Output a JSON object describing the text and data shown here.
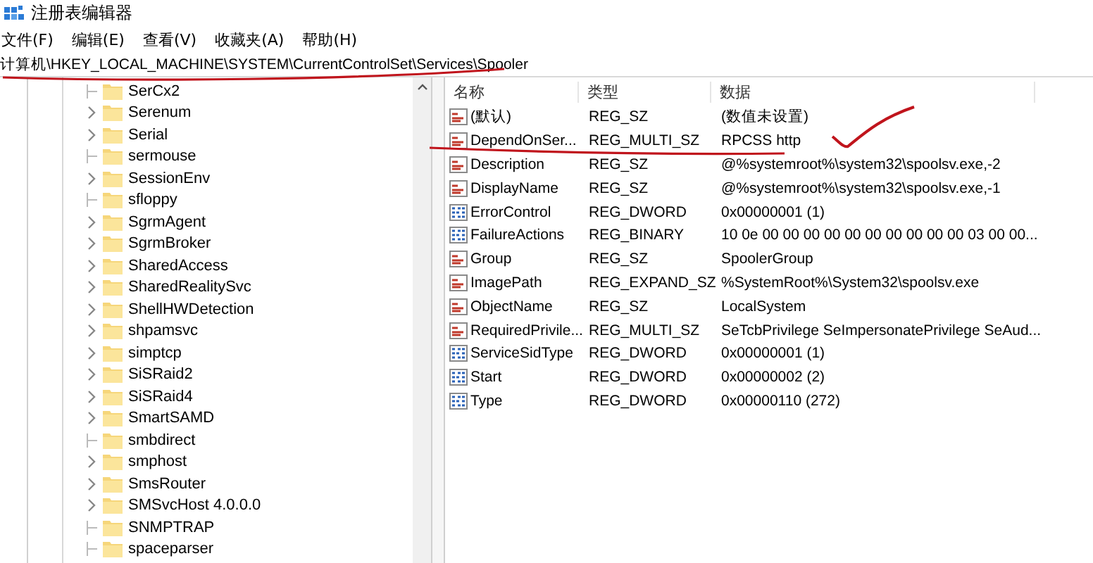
{
  "window": {
    "title": "注册表编辑器"
  },
  "menu": [
    "文件(F)",
    "编辑(E)",
    "查看(V)",
    "收藏夹(A)",
    "帮助(H)"
  ],
  "address": "计算机\\HKEY_LOCAL_MACHINE\\SYSTEM\\CurrentControlSet\\Services\\Spooler",
  "tree": [
    {
      "label": "SerCx2",
      "expandable": false
    },
    {
      "label": "Serenum",
      "expandable": true
    },
    {
      "label": "Serial",
      "expandable": true
    },
    {
      "label": "sermouse",
      "expandable": false
    },
    {
      "label": "SessionEnv",
      "expandable": true
    },
    {
      "label": "sfloppy",
      "expandable": false
    },
    {
      "label": "SgrmAgent",
      "expandable": true
    },
    {
      "label": "SgrmBroker",
      "expandable": true
    },
    {
      "label": "SharedAccess",
      "expandable": true
    },
    {
      "label": "SharedRealitySvc",
      "expandable": true
    },
    {
      "label": "ShellHWDetection",
      "expandable": true
    },
    {
      "label": "shpamsvc",
      "expandable": true
    },
    {
      "label": "simptcp",
      "expandable": true
    },
    {
      "label": "SiSRaid2",
      "expandable": true
    },
    {
      "label": "SiSRaid4",
      "expandable": true
    },
    {
      "label": "SmartSAMD",
      "expandable": true
    },
    {
      "label": "smbdirect",
      "expandable": false
    },
    {
      "label": "smphost",
      "expandable": true
    },
    {
      "label": "SmsRouter",
      "expandable": true
    },
    {
      "label": "SMSvcHost 4.0.0.0",
      "expandable": true
    },
    {
      "label": "SNMPTRAP",
      "expandable": false
    },
    {
      "label": "spaceparser",
      "expandable": false
    }
  ],
  "table": {
    "columns": [
      "名称",
      "类型",
      "数据"
    ],
    "rows": [
      {
        "kind": "string",
        "name": "(默认)",
        "type": "REG_SZ",
        "data": "(数值未设置)"
      },
      {
        "kind": "string",
        "name": "DependOnSer...",
        "type": "REG_MULTI_SZ",
        "data": "RPCSS http"
      },
      {
        "kind": "string",
        "name": "Description",
        "type": "REG_SZ",
        "data": "@%systemroot%\\system32\\spoolsv.exe,-2"
      },
      {
        "kind": "string",
        "name": "DisplayName",
        "type": "REG_SZ",
        "data": "@%systemroot%\\system32\\spoolsv.exe,-1"
      },
      {
        "kind": "binary",
        "name": "ErrorControl",
        "type": "REG_DWORD",
        "data": "0x00000001 (1)"
      },
      {
        "kind": "binary",
        "name": "FailureActions",
        "type": "REG_BINARY",
        "data": "10 0e 00 00 00 00 00 00 00 00 00 00 03 00 00..."
      },
      {
        "kind": "string",
        "name": "Group",
        "type": "REG_SZ",
        "data": "SpoolerGroup"
      },
      {
        "kind": "string",
        "name": "ImagePath",
        "type": "REG_EXPAND_SZ",
        "data": "%SystemRoot%\\System32\\spoolsv.exe"
      },
      {
        "kind": "string",
        "name": "ObjectName",
        "type": "REG_SZ",
        "data": "LocalSystem"
      },
      {
        "kind": "string",
        "name": "RequiredPrivile...",
        "type": "REG_MULTI_SZ",
        "data": "SeTcbPrivilege SeImpersonatePrivilege SeAud..."
      },
      {
        "kind": "binary",
        "name": "ServiceSidType",
        "type": "REG_DWORD",
        "data": "0x00000001 (1)"
      },
      {
        "kind": "binary",
        "name": "Start",
        "type": "REG_DWORD",
        "data": "0x00000002 (2)"
      },
      {
        "kind": "binary",
        "name": "Type",
        "type": "REG_DWORD",
        "data": "0x00000110 (272)"
      }
    ]
  }
}
